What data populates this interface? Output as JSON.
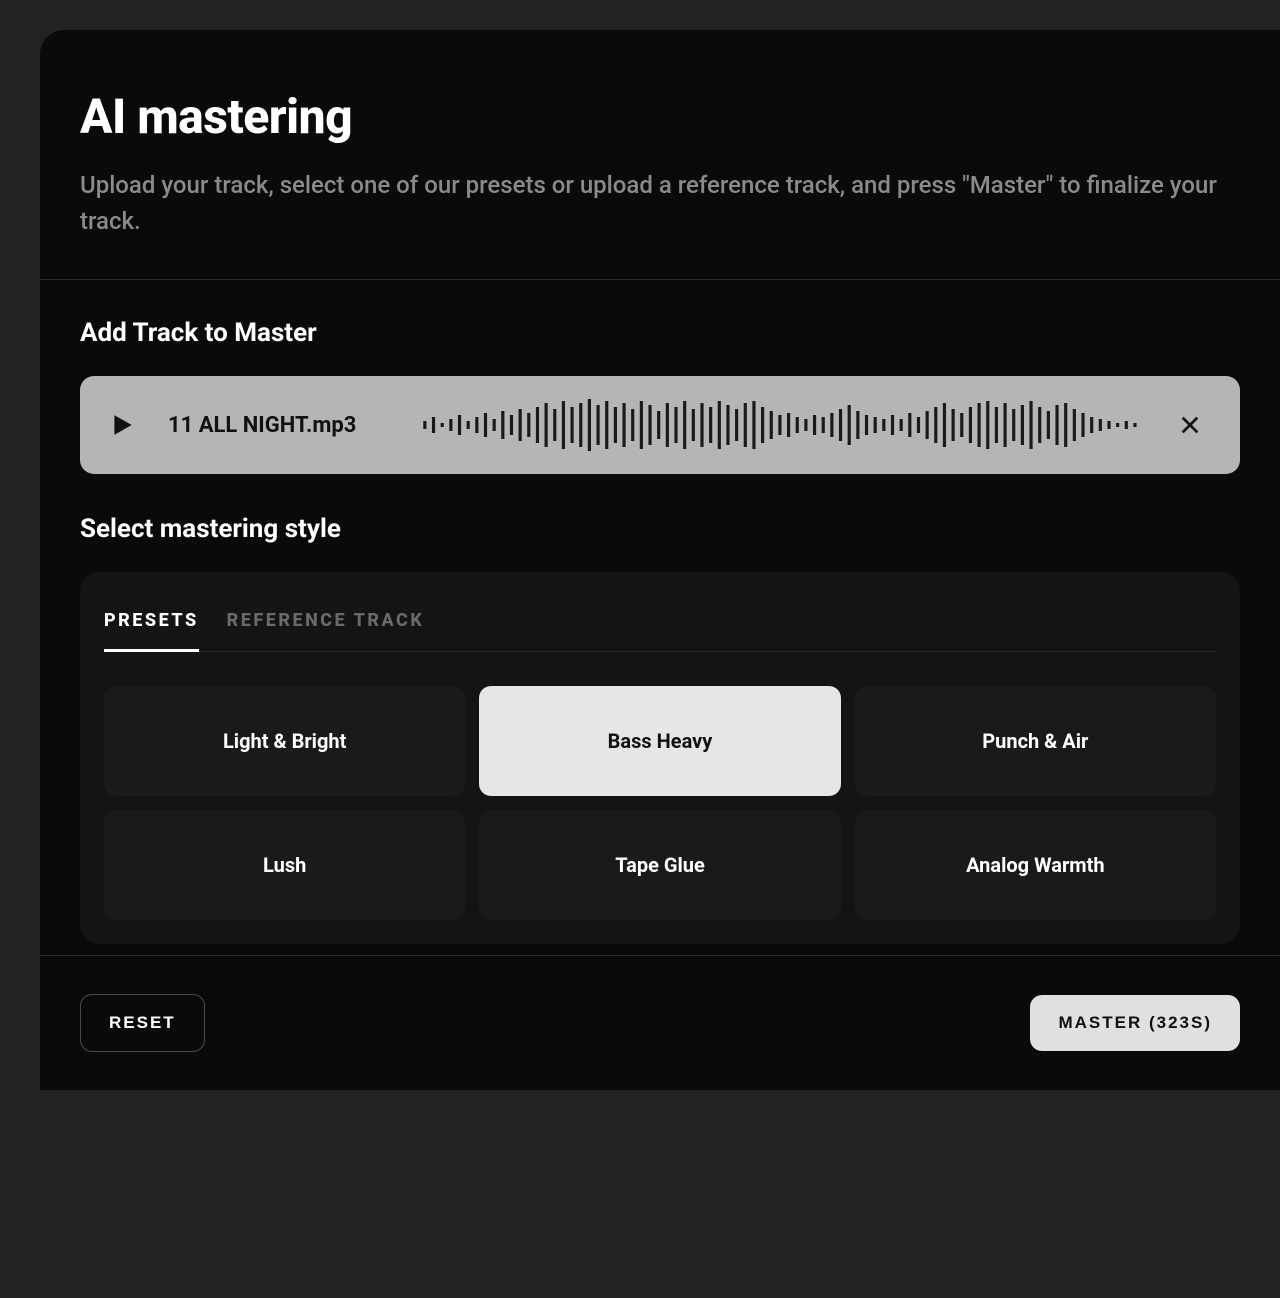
{
  "header": {
    "title": "AI mastering",
    "subtitle": "Upload your track, select one of our presets or upload a reference track, and press \"Master\" to finalize your track."
  },
  "track_section": {
    "title": "Add Track to Master",
    "file_name": "11 ALL NIGHT.mp3"
  },
  "style_section": {
    "title": "Select mastering style",
    "tabs": [
      {
        "label": "PRESETS",
        "active": true
      },
      {
        "label": "REFERENCE TRACK",
        "active": false
      }
    ],
    "presets": [
      {
        "label": "Light & Bright",
        "selected": false
      },
      {
        "label": "Bass Heavy",
        "selected": true
      },
      {
        "label": "Punch & Air",
        "selected": false
      },
      {
        "label": "Lush",
        "selected": false
      },
      {
        "label": "Tape Glue",
        "selected": false
      },
      {
        "label": "Analog Warmth",
        "selected": false
      }
    ]
  },
  "footer": {
    "reset_label": "RESET",
    "master_label": "MASTER (323S)"
  }
}
